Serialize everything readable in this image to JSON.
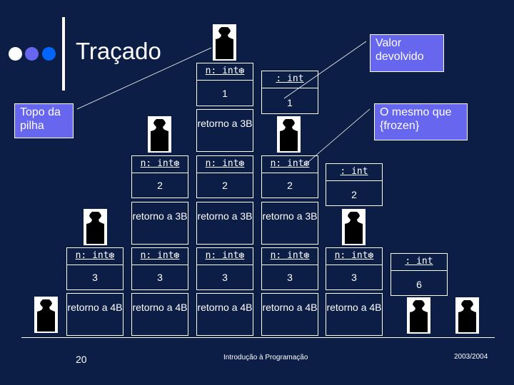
{
  "slide": {
    "title": "Traçado",
    "bullet_colors": [
      "#ffffff",
      "#6666ee",
      "#0066ff"
    ],
    "callout_color": "#6666ee",
    "background_color": "#0c1e45"
  },
  "callouts": {
    "top_of_stack": "Topo da pilha",
    "return_value": "Valor devolvido",
    "same_as_frozen": "O mesmo que {frozen}"
  },
  "object_labels": {
    "param": "n: int❆",
    "result": ": int",
    "return_3b": "retorno a 3B",
    "return_4b": "retorno a 4B"
  },
  "stack_frames": {
    "level1": {
      "param_value": "1",
      "result_value": "1"
    },
    "level2": {
      "param_values": [
        "2",
        "2",
        "2"
      ],
      "result_value": "2"
    },
    "level3": {
      "param_values": [
        "3",
        "3",
        "3",
        "3",
        "3"
      ],
      "result_value": "6"
    }
  },
  "icons": {
    "figure": "person-silhouette-icon",
    "frozen": "snowflake-icon"
  },
  "footer": {
    "page_number": "20",
    "course": "Introdução à Programação",
    "year": "2003/2004"
  }
}
